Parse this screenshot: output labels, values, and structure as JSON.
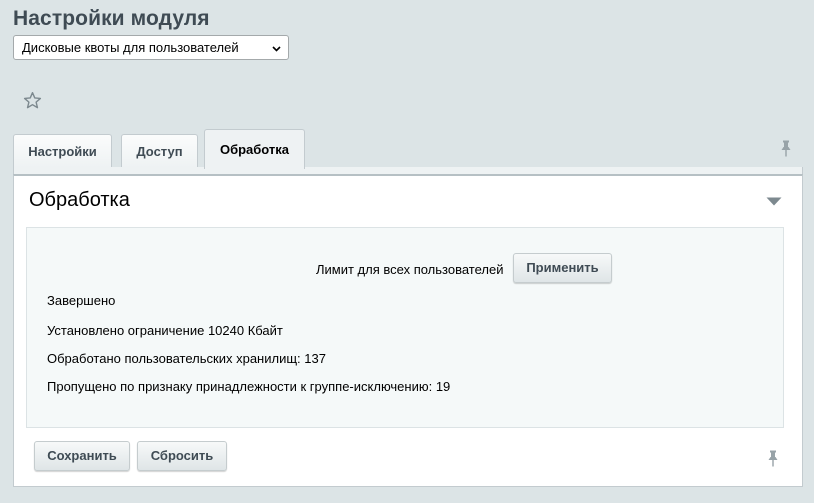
{
  "page": {
    "title": "Настройки модуля"
  },
  "module_select": {
    "selected": "Дисковые квоты для пользователей"
  },
  "favorite": {
    "icon": "star-icon"
  },
  "tabs": [
    {
      "label": "Настройки",
      "active": false
    },
    {
      "label": "Доступ",
      "active": false
    },
    {
      "label": "Обработка",
      "active": true
    }
  ],
  "section": {
    "title": "Обработка"
  },
  "processing": {
    "limit_label": "Лимит для всех пользователей",
    "apply_label": "Применить",
    "messages": [
      "Завершено",
      "Установлено ограничение 10240 Кбайт",
      "Обработано пользовательских хранилищ: 137",
      "Пропущено по признаку принадлежности к группе-исключению: 19"
    ]
  },
  "footer": {
    "save_label": "Сохранить",
    "reset_label": "Сбросить"
  },
  "colors": {
    "title": "#3f4b54",
    "background": "#dce4e6",
    "inner_box": "#f5f9f9"
  }
}
